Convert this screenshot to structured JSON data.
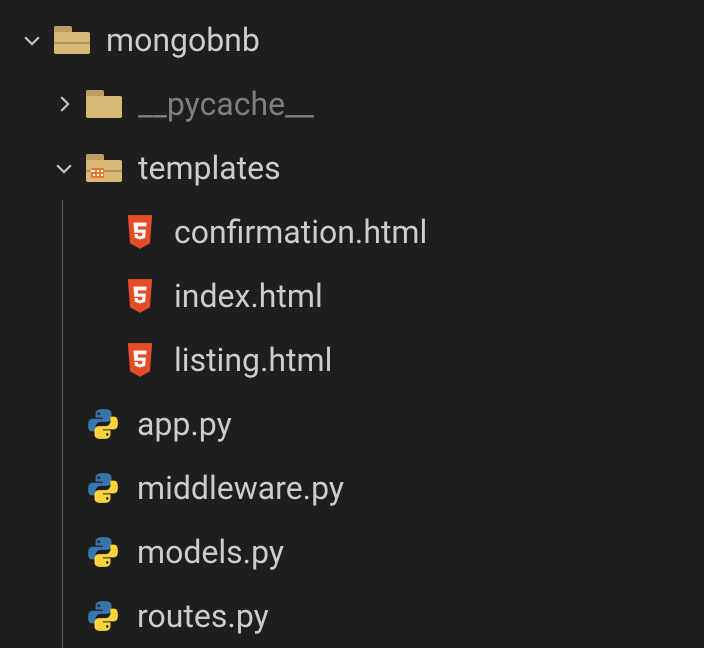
{
  "tree": {
    "root": {
      "name": "mongobnb",
      "expanded": true,
      "children": {
        "pycache": {
          "name": "__pycache__",
          "expanded": false
        },
        "templates": {
          "name": "templates",
          "expanded": true,
          "children": {
            "confirmation": {
              "name": "confirmation.html"
            },
            "index": {
              "name": "index.html"
            },
            "listing": {
              "name": "listing.html"
            }
          }
        },
        "app": {
          "name": "app.py"
        },
        "middleware": {
          "name": "middleware.py"
        },
        "models": {
          "name": "models.py"
        },
        "routes": {
          "name": "routes.py"
        }
      }
    }
  }
}
